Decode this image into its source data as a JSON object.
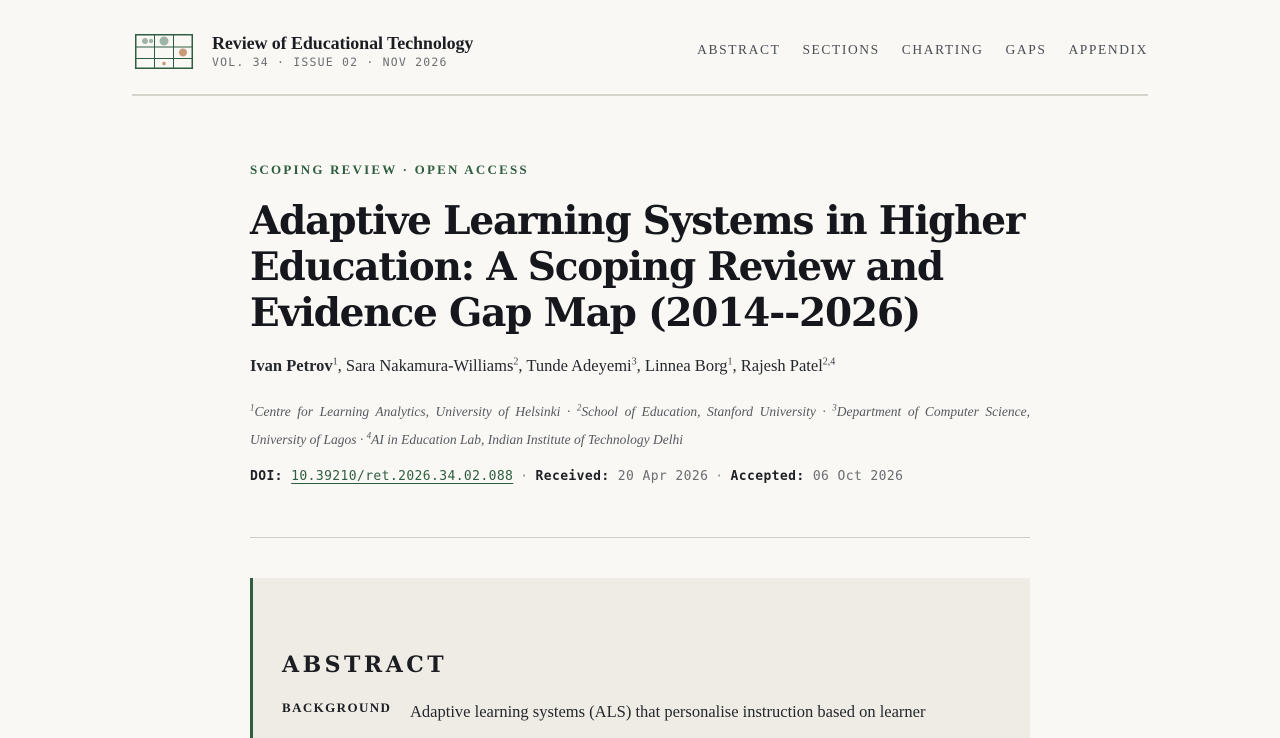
{
  "header": {
    "journal_name": "Review of Educational Technology",
    "journal_meta": "VOL. 34 · ISSUE 02 · NOV 2026",
    "logo_icon": "journal-grid-logo",
    "nav": [
      {
        "label": "ABSTRACT"
      },
      {
        "label": "SECTIONS"
      },
      {
        "label": "CHARTING"
      },
      {
        "label": "GAPS"
      },
      {
        "label": "APPENDIX"
      }
    ]
  },
  "article": {
    "kicker": "SCOPING REVIEW · OPEN ACCESS",
    "title": "Adaptive Learning Systems in Higher Education: A Scoping Review and Evidence Gap Map (2014--2026)",
    "authors": [
      {
        "name": "Ivan Petrov",
        "sup": "1"
      },
      {
        "name": "Sara Nakamura-Williams",
        "sup": "2"
      },
      {
        "name": "Tunde Adeyemi",
        "sup": "3"
      },
      {
        "name": "Linnea Borg",
        "sup": "1"
      },
      {
        "name": "Rajesh Patel",
        "sup": "2,4"
      }
    ],
    "affiliations": [
      {
        "sup": "1",
        "text": "Centre for Learning Analytics, University of Helsinki"
      },
      {
        "sup": "2",
        "text": "School of Education, Stanford University"
      },
      {
        "sup": "3",
        "text": "Department of Computer Science, University of Lagos"
      },
      {
        "sup": "4",
        "text": "AI in Education Lab, Indian Institute of Technology Delhi"
      }
    ],
    "doi_label": "DOI:",
    "doi": "10.39210/ret.2026.34.02.088",
    "received_label": "Received:",
    "received": "20 Apr 2026",
    "accepted_label": "Accepted:",
    "accepted": "06 Oct 2026"
  },
  "abstract": {
    "heading": "ABSTRACT",
    "background_label": "BACKGROUND",
    "background_text": "Adaptive learning systems (ALS) that personalise instruction based on learner"
  },
  "colors": {
    "accent": "#2f5d3f",
    "background": "#f9f8f5",
    "abstract_bg": "#efece5",
    "logo_dot_green": "#9fb3a6",
    "logo_dot_tan": "#c99a78"
  }
}
